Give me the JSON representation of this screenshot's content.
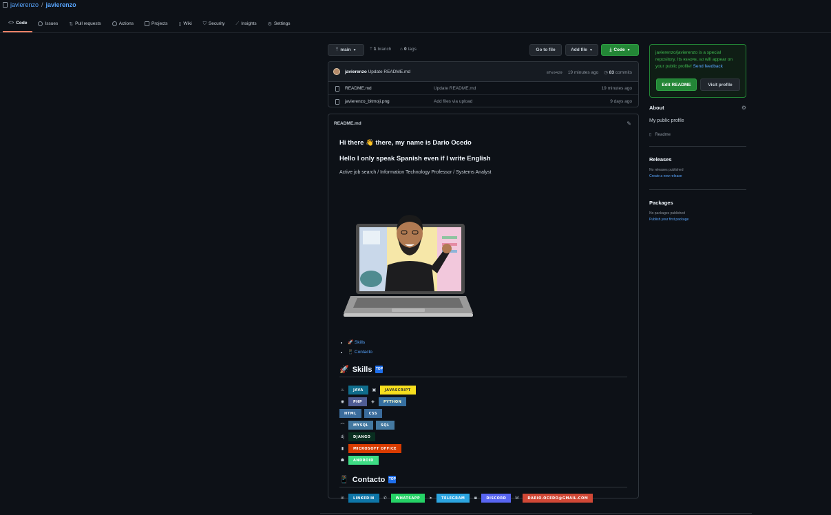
{
  "repo": {
    "owner": "javierenzo",
    "name": "javierenzo",
    "separator": "/"
  },
  "tabs": [
    {
      "label": "Code",
      "icon": "code-icon"
    },
    {
      "label": "Issues",
      "icon": "issue-icon"
    },
    {
      "label": "Pull requests",
      "icon": "pull-request-icon"
    },
    {
      "label": "Actions",
      "icon": "play-icon"
    },
    {
      "label": "Projects",
      "icon": "table-icon"
    },
    {
      "label": "Wiki",
      "icon": "book-icon"
    },
    {
      "label": "Security",
      "icon": "shield-icon"
    },
    {
      "label": "Insights",
      "icon": "graph-icon"
    },
    {
      "label": "Settings",
      "icon": "gear-icon"
    }
  ],
  "toolbar": {
    "branch": "main",
    "branch_count": "1",
    "branch_label": "branch",
    "tag_count": "0",
    "tag_label": "tags",
    "go_to_file": "Go to file",
    "add_file": "Add file",
    "code": "Code"
  },
  "last_commit": {
    "author": "javierenzo",
    "message": "Update README.md",
    "hash": "8fe0429",
    "age": "19 minutes ago",
    "commit_count": "83",
    "commit_label": "commits"
  },
  "files": [
    {
      "name": "README.md",
      "message": "Update README.md",
      "age": "19 minutes ago"
    },
    {
      "name": "javierenzo_bitmoji.png",
      "message": "Add files via upload",
      "age": "9 days ago"
    }
  ],
  "readme": {
    "filename": "README.md",
    "greeting": "Hi there 👋 there, my name is Dario Ocedo",
    "subtitle": "Hello I only speak Spanish even if I write English",
    "tagline": "Active job search / Information Technology Professor / Systems Analyst",
    "toc": [
      {
        "icon": "🚀",
        "label": "Skills"
      },
      {
        "icon": "📱",
        "label": "Contacto"
      }
    ],
    "skills_title": "Skills",
    "skills_icon": "🚀",
    "contact_title": "Contacto",
    "contact_icon": "📱",
    "up_badge": "TOP",
    "skills": [
      [
        {
          "icon": "♨",
          "label": "JAVA",
          "color": "#0f6d8c",
          "text": "#ffffff"
        },
        {
          "icon": "▣",
          "label": "JAVASCRIPT",
          "color": "#f7df1e",
          "text": "#323330"
        }
      ],
      [
        {
          "icon": "◉",
          "label": "PHP",
          "color": "#4f5d95",
          "text": "#ffffff"
        },
        {
          "icon": "◈",
          "label": "PYTHON",
          "color": "#3670a0",
          "text": "#ffffd0"
        }
      ],
      [
        {
          "icon": "",
          "label": "HTML",
          "color": "#3b6c9c",
          "text": "#ffffff"
        },
        {
          "icon": "",
          "label": "CSS",
          "color": "#3b6c9c",
          "text": "#ffffff"
        }
      ],
      [
        {
          "icon": "⌒",
          "label": "MYSQL",
          "color": "#4479a1",
          "text": "#ffffff"
        },
        {
          "icon": "",
          "label": "SQL",
          "color": "#4479a1",
          "text": "#ffffff"
        }
      ],
      [
        {
          "icon": "dj",
          "label": "DJANGO",
          "color": "#092e20",
          "text": "#ffffff"
        }
      ],
      [
        {
          "icon": "▮",
          "label": "MICROSOFT OFFICE",
          "color": "#d83b01",
          "text": "#ffffff"
        }
      ],
      [
        {
          "icon": "☗",
          "label": "ANDROID",
          "color": "#3ddc84",
          "text": "#ffffff"
        }
      ]
    ],
    "contacts": [
      {
        "icon": "in",
        "label": "LINKEDIN",
        "color": "#0e76a8"
      },
      {
        "icon": "✆",
        "label": "WHATSAPP",
        "color": "#25d366"
      },
      {
        "icon": "➤",
        "label": "TELEGRAM",
        "color": "#2ca5e0"
      },
      {
        "icon": "◙",
        "label": "DISCORD",
        "color": "#5865f2"
      },
      {
        "icon": "M",
        "label": "DARIO.OCEDO@GMAIL.COM",
        "color": "#d14836"
      }
    ]
  },
  "sidebar": {
    "callout": {
      "repo": "javierenzo/javierenzo",
      "text1": " is a special repository. Its ",
      "readme": "README.md",
      "text2": " will appear on your public profile! ",
      "feedback": "Send feedback",
      "edit": "Edit README",
      "visit": "Visit profile"
    },
    "about": {
      "title": "About",
      "profile": "My public profile",
      "readme": "Readme"
    },
    "releases": {
      "title": "Releases",
      "none": "No releases published",
      "create": "Create a new release"
    },
    "packages": {
      "title": "Packages",
      "none": "No packages published",
      "publish": "Publish your first package"
    }
  }
}
